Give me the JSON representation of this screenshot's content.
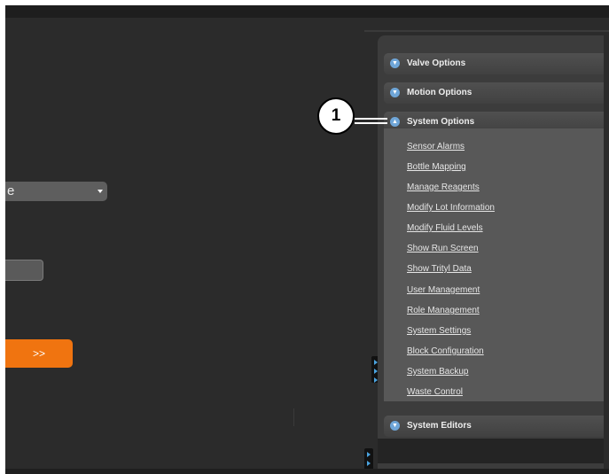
{
  "left_form": {
    "select_value": "e",
    "next_button_label": ">>"
  },
  "panel": {
    "sections": {
      "valve_options": "Valve Options",
      "motion_options": "Motion Options",
      "system_options": "System Options",
      "system_editors": "System Editors"
    },
    "system_options_links": [
      "Sensor Alarms",
      "Bottle Mapping",
      "Manage Reagents",
      "Modify Lot Information",
      "Modify Fluid Levels",
      "Show Run Screen",
      "Show Trityl Data",
      "User Management",
      "Role Management",
      "System Settings",
      "Block Configuration",
      "System Backup",
      "Waste Control"
    ]
  },
  "callout": {
    "number": "1"
  },
  "colors": {
    "accent_orange": "#f07410",
    "panel_dark": "#3c3c3c",
    "link_area": "#585858",
    "chevron_blue": "#6fa6d8"
  },
  "icons": {
    "section_collapsed": "chevron-down-icon",
    "section_expanded": "chevron-up-icon",
    "dropdown": "caret-down-icon",
    "splitter": "triangle-right-icon"
  }
}
